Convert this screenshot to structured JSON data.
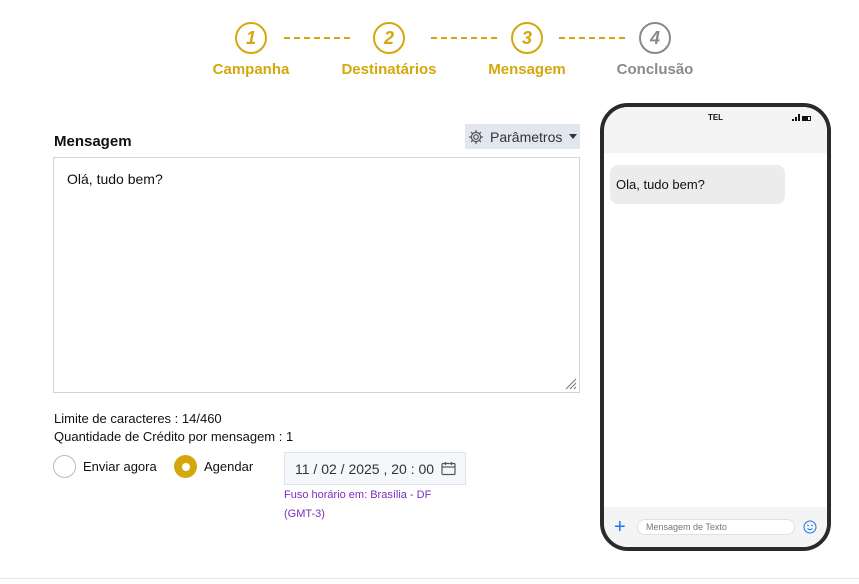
{
  "stepper": {
    "steps": [
      {
        "number": "1",
        "label": "Campanha"
      },
      {
        "number": "2",
        "label": "Destinatários"
      },
      {
        "number": "3",
        "label": "Mensagem"
      },
      {
        "number": "4",
        "label": "Conclusão"
      }
    ]
  },
  "message": {
    "title": "Mensagem",
    "params_label": "Parâmetros",
    "text": "Olá, tudo bem?",
    "char_limit": "Limite de caracteres : 14/460",
    "credit_qty": "Quantidade de Crédito por mensagem : 1"
  },
  "schedule": {
    "send_now_label": "Enviar agora",
    "schedule_label": "Agendar",
    "date_display": "11 / 02 / 2025 ,  20 : 00",
    "timezone_line1": "Fuso horário em: Brasília - DF",
    "timezone_line2": "(GMT-3)"
  },
  "phone": {
    "carrier": "TEL",
    "bubble_text": "Ola, tudo bem?",
    "input_placeholder": "Mensagem de Texto"
  },
  "colors": {
    "accent": "#d4a80c",
    "inactive": "#8a8a8a",
    "timezone": "#7b2cbf",
    "plus_blue": "#1a73e8"
  },
  "icons": [
    "gear-icon",
    "caret-down-icon",
    "calendar-icon",
    "plus-icon",
    "emoji-icon",
    "signal-icon",
    "battery-icon",
    "resize-grip-icon"
  ]
}
